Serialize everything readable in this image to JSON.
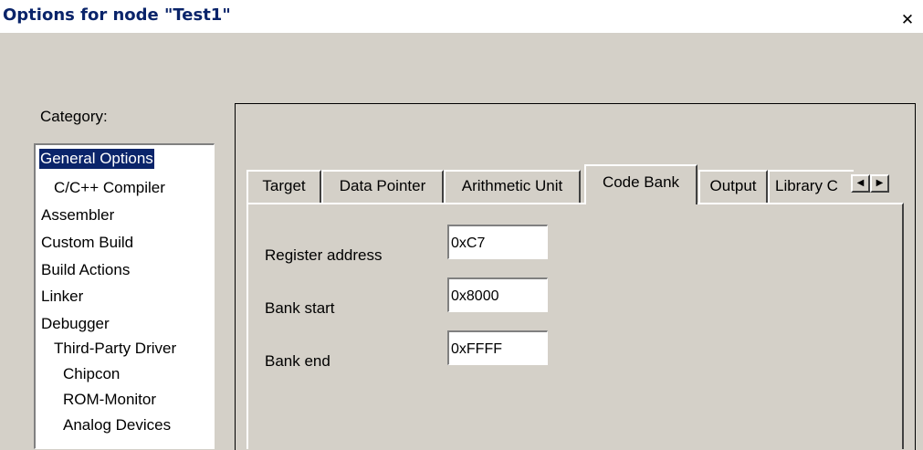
{
  "window": {
    "title": "Options for node \"Test1\"",
    "close_glyph": "✕"
  },
  "category": {
    "label": "Category:",
    "items": [
      {
        "label": "General Options",
        "selected": true
      },
      {
        "label": "C/C++ Compiler"
      },
      {
        "label": "Assembler"
      },
      {
        "label": "Custom Build"
      },
      {
        "label": "Build Actions"
      },
      {
        "label": "Linker"
      },
      {
        "label": "Debugger"
      },
      {
        "label": "Third-Party Driver"
      },
      {
        "label": "Chipcon"
      },
      {
        "label": "ROM-Monitor"
      },
      {
        "label": "Analog Devices"
      }
    ]
  },
  "tabs": [
    {
      "label": "Target"
    },
    {
      "label": "Data Pointer"
    },
    {
      "label": "Arithmetic Unit"
    },
    {
      "label": "Code Bank",
      "active": true
    },
    {
      "label": "Output"
    },
    {
      "label": "Library C"
    }
  ],
  "tab_scroll": {
    "left_glyph": "◀",
    "right_glyph": "▶"
  },
  "code_bank": {
    "register_address": {
      "label": "Register address",
      "value": "0xC7"
    },
    "bank_start": {
      "label": "Bank start",
      "value": "0x8000"
    },
    "bank_end": {
      "label": "Bank end",
      "value": "0xFFFF"
    }
  },
  "colors": {
    "face": "#d4d0c8",
    "selection": "#0a246a",
    "title_text": "#0a246a"
  }
}
